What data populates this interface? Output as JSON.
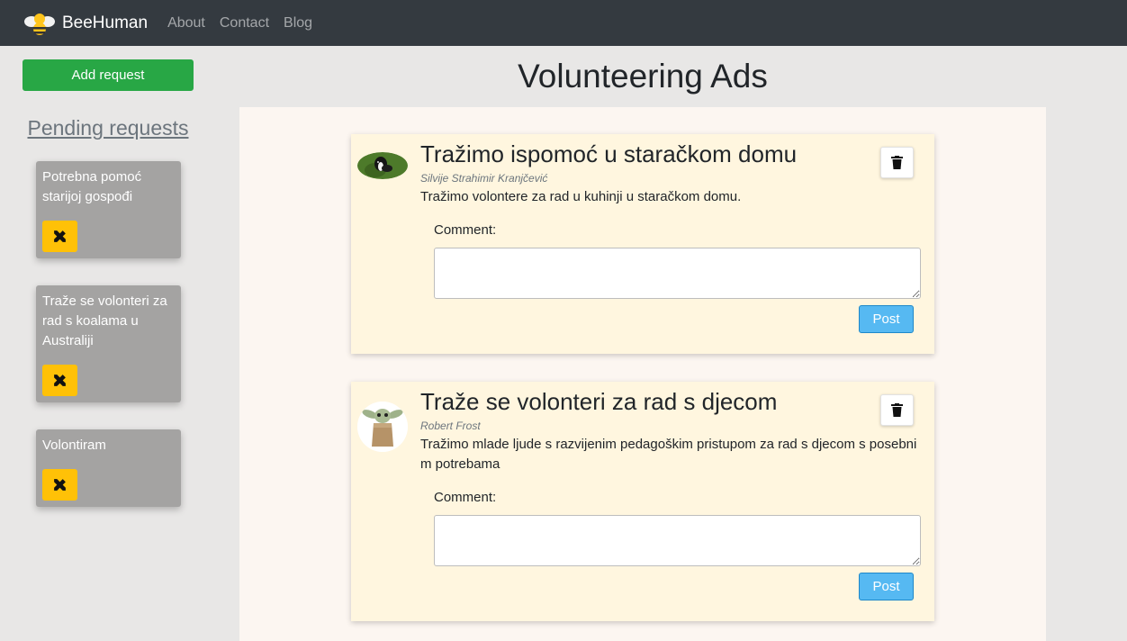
{
  "navbar": {
    "brand": "BeeHuman",
    "links": [
      "About",
      "Contact",
      "Blog"
    ]
  },
  "sidebar": {
    "add_request_label": "Add request",
    "pending_title": "Pending requests",
    "requests": [
      {
        "title": "Potrebna pomoć starijoj gospođi",
        "action_icon": "tools-icon"
      },
      {
        "title": "Traže se volonteri za rad s koalama u Australiji",
        "action_icon": "tools-icon"
      },
      {
        "title": "Volontiram",
        "action_icon": "tools-icon"
      }
    ]
  },
  "main": {
    "title": "Volunteering Ads",
    "ads": [
      {
        "title": "Tražimo ispomoć u staračkom domu",
        "author": "Silvije Strahimir Kranjčević",
        "description": "Tražimo volontere za rad u kuhinji u staračkom domu.",
        "comment_label": "Comment:",
        "comment_value": "",
        "post_label": "Post",
        "avatar": "dog-avatar"
      },
      {
        "title": "Traže se volonteri za rad s djecom",
        "author": "Robert Frost",
        "description": "Tražimo mlade ljude s razvijenim pedagoškim pristupom za rad s djecom s posebni m potrebama",
        "comment_label": "Comment:",
        "comment_value": "",
        "post_label": "Post",
        "avatar": "baby-yoda-avatar"
      }
    ]
  },
  "colors": {
    "navbar": "#343a40",
    "add_button": "#28a745",
    "tool_button": "#ffc107",
    "post_button": "#56b9f2",
    "ad_card": "#fff6df",
    "request_card": "#a4a3a2"
  }
}
